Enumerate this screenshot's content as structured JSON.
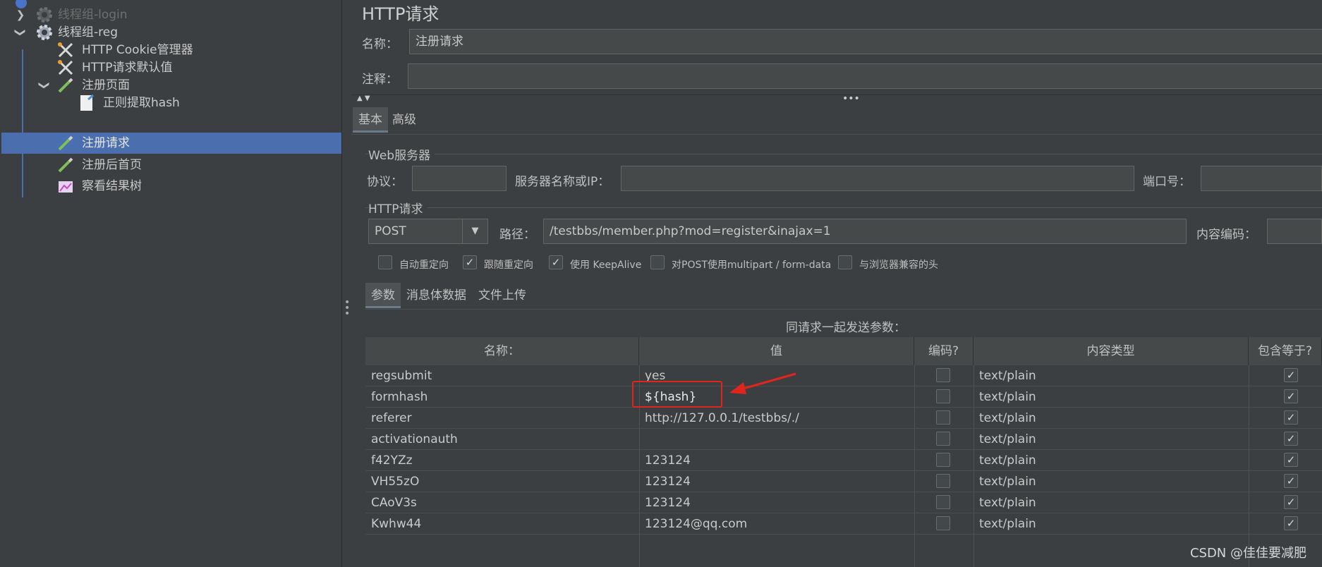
{
  "tree": {
    "items": [
      {
        "label": "线程组-login"
      },
      {
        "label": "线程组-reg"
      },
      {
        "label": "HTTP Cookie管理器"
      },
      {
        "label": "HTTP请求默认值"
      },
      {
        "label": "注册页面"
      },
      {
        "label": "正则提取hash"
      },
      {
        "label": "注册请求"
      },
      {
        "label": "注册后首页"
      },
      {
        "label": "察看结果树"
      }
    ]
  },
  "panel": {
    "title": "HTTP请求",
    "name_label": "名称：",
    "name_value": "注册请求",
    "comment_label": "注释：",
    "comment_value": "",
    "tabs": [
      "基本",
      "高级"
    ],
    "web_server": {
      "group_title": "Web服务器",
      "protocol_label": "协议：",
      "protocol_value": "",
      "server_label": "服务器名称或IP：",
      "server_value": "",
      "port_label": "端口号：",
      "port_value": ""
    },
    "http_request": {
      "group_title": "HTTP请求",
      "method": "POST",
      "path_label": "路径：",
      "path_value": "/testbbs/member.php?mod=register&inajax=1",
      "encoding_label": "内容编码：",
      "encoding_value": ""
    },
    "options": [
      {
        "label": "自动重定向",
        "checked": false
      },
      {
        "label": "跟随重定向",
        "checked": true
      },
      {
        "label": "使用 KeepAlive",
        "checked": true
      },
      {
        "label": "对POST使用multipart / form-data",
        "checked": false
      },
      {
        "label": "与浏览器兼容的头",
        "checked": false
      }
    ],
    "sub_tabs": [
      "参数",
      "消息体数据",
      "文件上传"
    ],
    "params_caption": "同请求一起发送参数：",
    "table": {
      "headers": [
        "名称：",
        "值",
        "编码?",
        "内容类型",
        "包含等于?"
      ],
      "rows": [
        {
          "name": "regsubmit",
          "value": "yes",
          "encode": false,
          "content_type": "text/plain",
          "include_equals": true
        },
        {
          "name": "formhash",
          "value": "${hash}",
          "encode": false,
          "content_type": "text/plain",
          "include_equals": true
        },
        {
          "name": "referer",
          "value": "http://127.0.0.1/testbbs/./",
          "encode": false,
          "content_type": "text/plain",
          "include_equals": true
        },
        {
          "name": "activationauth",
          "value": "",
          "encode": false,
          "content_type": "text/plain",
          "include_equals": true
        },
        {
          "name": "f42YZz",
          "value": "123124",
          "encode": false,
          "content_type": "text/plain",
          "include_equals": true
        },
        {
          "name": "VH55zO",
          "value": "123124",
          "encode": false,
          "content_type": "text/plain",
          "include_equals": true
        },
        {
          "name": "CAoV3s",
          "value": "123124",
          "encode": false,
          "content_type": "text/plain",
          "include_equals": true
        },
        {
          "name": "Kwhw44",
          "value": "123124@qq.com",
          "encode": false,
          "content_type": "text/plain",
          "include_equals": true
        }
      ]
    }
  },
  "annotation": {
    "color": "#e0261c"
  },
  "watermark": "CSDN @佳佳要减肥"
}
